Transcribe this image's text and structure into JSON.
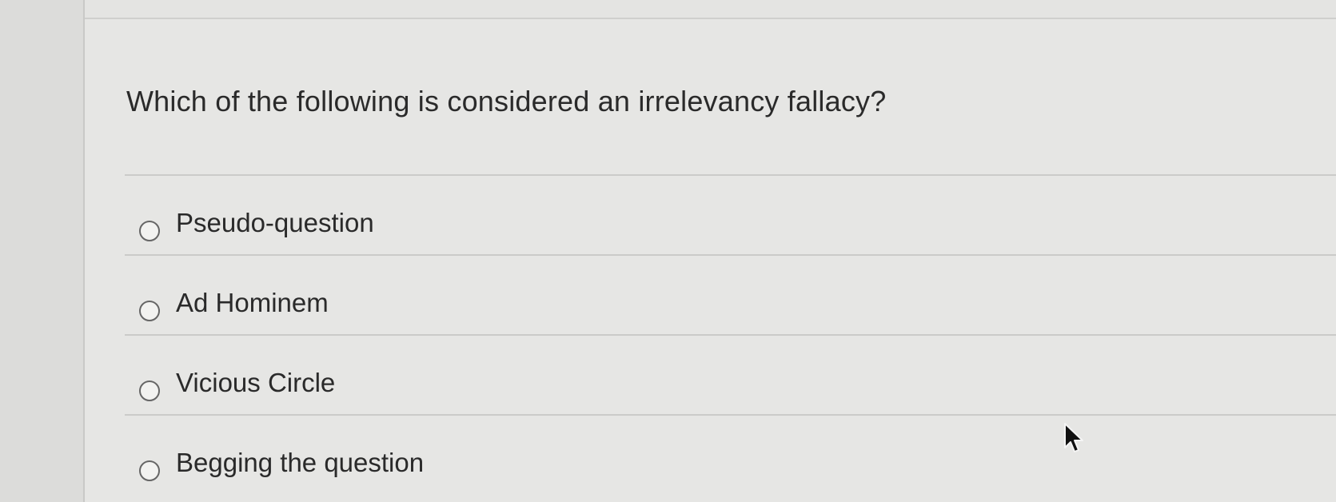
{
  "question": {
    "text": "Which of the following is considered an irrelevancy fallacy?"
  },
  "answers": [
    {
      "label": "Pseudo-question"
    },
    {
      "label": "Ad Hominem"
    },
    {
      "label": "Vicious Circle"
    },
    {
      "label": "Begging the question"
    }
  ],
  "colors": {
    "background": "#e4e4e2",
    "text": "#2a2a2a",
    "divider": "#cbcbc9",
    "radio_border": "#666666"
  },
  "icons": {
    "radio": "radio-unselected-icon",
    "cursor": "mouse-pointer-icon"
  }
}
